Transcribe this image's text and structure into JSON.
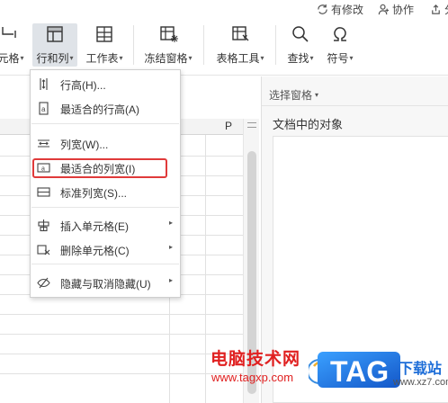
{
  "topbar": {
    "unsaved_label": "有修改",
    "collab_label": "协作",
    "share_partial": "分"
  },
  "ribbon": {
    "cell_partial": "元格",
    "rowcol_label": "行和列",
    "worksheet_label": "工作表",
    "freeze_label": "冻结窗格",
    "table_tools_label": "表格工具",
    "find_label": "查找",
    "symbol_label": "符号",
    "caret": "▾"
  },
  "sheet": {
    "column_letter": "P"
  },
  "menu": {
    "items": [
      {
        "label": "行高(H)...",
        "icon": "row-height-icon",
        "submenu": false
      },
      {
        "label": "最适合的行高(A)",
        "icon": "autofit-row-height-icon",
        "submenu": false
      },
      {
        "label": "列宽(W)...",
        "icon": "column-width-icon",
        "submenu": false
      },
      {
        "label": "最适合的列宽(I)",
        "icon": "autofit-column-width-icon",
        "submenu": false
      },
      {
        "label": "标准列宽(S)...",
        "icon": "standard-column-width-icon",
        "submenu": false
      },
      {
        "label": "插入单元格(E)",
        "icon": "insert-cells-icon",
        "submenu": true
      },
      {
        "label": "删除单元格(C)",
        "icon": "delete-cells-icon",
        "submenu": true
      },
      {
        "label": "隐藏与取消隐藏(U)",
        "icon": "hide-unhide-icon",
        "submenu": true
      }
    ],
    "submenu_arrow": "▸",
    "highlight_color": "#e03a3a"
  },
  "pane": {
    "title": "选择窗格",
    "subtitle": "文档中的对象"
  },
  "watermark": {
    "site_name": "电脑技术网",
    "site_url": "www.tagxp.com",
    "badge_text": "TAG",
    "download_text": "下载站",
    "download_url": "www.xz7.com",
    "red": "#e02020",
    "blue": "#1e6ed8"
  }
}
